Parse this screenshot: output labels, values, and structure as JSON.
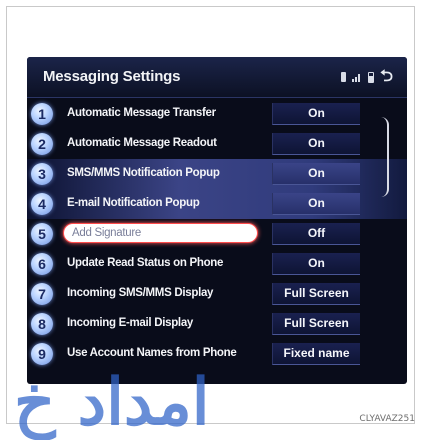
{
  "screen": {
    "title": "Messaging Settings",
    "status_icons": [
      "bluetooth-icon",
      "signal-icon",
      "battery-icon",
      "back-icon"
    ]
  },
  "rows": [
    {
      "number": "1",
      "label": "Automatic Message Transfer",
      "value": "On"
    },
    {
      "number": "2",
      "label": "Automatic Message Readout",
      "value": "On"
    },
    {
      "number": "3",
      "label": "SMS/MMS Notification Popup",
      "value": "On"
    },
    {
      "number": "4",
      "label": "E-mail Notification Popup",
      "value": "On"
    },
    {
      "number": "5",
      "label": "Add Signature",
      "value": "Off"
    },
    {
      "number": "6",
      "label": "Update Read Status on Phone",
      "value": "On"
    },
    {
      "number": "7",
      "label": "Incoming SMS/MMS Display",
      "value": "Full Screen"
    },
    {
      "number": "8",
      "label": "Incoming E-mail Display",
      "value": "Full Screen"
    },
    {
      "number": "9",
      "label": "Use Account Names from Phone",
      "value": "Fixed name"
    }
  ],
  "caption": "CLYAVAZ251",
  "watermark": "امداد خ",
  "colors": {
    "screen_bg": "#090c1a",
    "highlight": "#3b4486",
    "badge": "#b9d3ff",
    "selection_border": "#ff4d4d"
  }
}
